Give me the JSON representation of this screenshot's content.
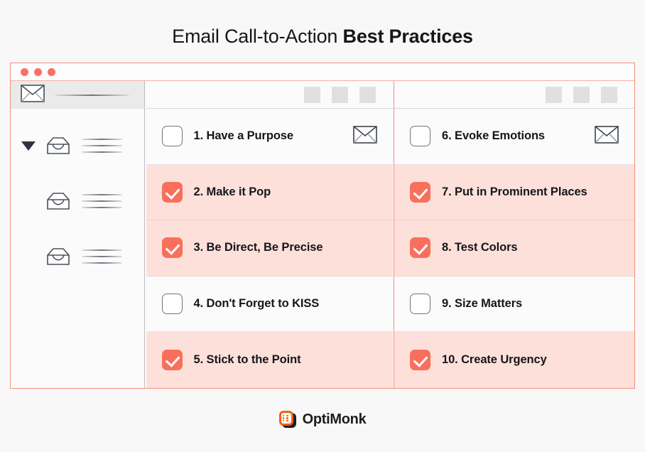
{
  "title": {
    "light": "Email Call-to-Action ",
    "bold": "Best Practices"
  },
  "colors": {
    "accent": "#f8705c",
    "accent_soft": "#fde0da",
    "frame_border": "#f2907f",
    "page_bg": "#f8f8f8",
    "text": "#15161a",
    "logo_orange": "#fb5c0a"
  },
  "window": {
    "dots": [
      "dot-1",
      "dot-2",
      "dot-3"
    ],
    "sidebar": {
      "header_icon": "closed-envelope-icon",
      "items": [
        {
          "caret": true,
          "icon": "open-envelope-icon",
          "lines": 3
        },
        {
          "caret": false,
          "icon": "open-envelope-icon",
          "lines": 3
        },
        {
          "caret": false,
          "icon": "open-envelope-icon",
          "lines": 3
        }
      ]
    },
    "toolbar_squares": 3
  },
  "columns": [
    {
      "name": "left-column",
      "rows": [
        {
          "label": "1. Have a Purpose",
          "checked": false,
          "icon": "closed-envelope-icon"
        },
        {
          "label": "2. Make it Pop",
          "checked": true,
          "icon": null
        },
        {
          "label": "3. Be Direct, Be Precise",
          "checked": true,
          "icon": null
        },
        {
          "label": "4. Don't Forget to KISS",
          "checked": false,
          "icon": null
        },
        {
          "label": "5. Stick to the Point",
          "checked": true,
          "icon": null
        }
      ]
    },
    {
      "name": "right-column",
      "rows": [
        {
          "label": "6. Evoke Emotions",
          "checked": false,
          "icon": "closed-envelope-icon"
        },
        {
          "label": "7. Put in Prominent Places",
          "checked": true,
          "icon": null
        },
        {
          "label": "8. Test Colors",
          "checked": true,
          "icon": null
        },
        {
          "label": "9. Size Matters",
          "checked": false,
          "icon": null
        },
        {
          "label": "10. Create Urgency",
          "checked": true,
          "icon": null
        }
      ]
    }
  ],
  "footer": {
    "logo_icon": "optimonk-logo-icon",
    "brand": "OptiMonk"
  }
}
